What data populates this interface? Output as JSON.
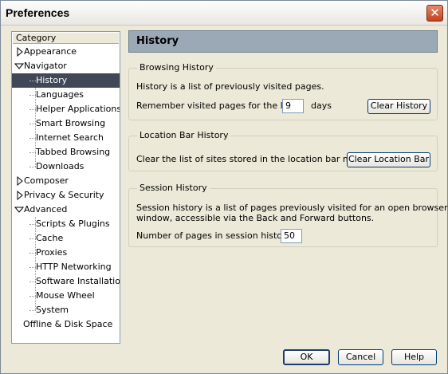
{
  "window": {
    "title": "Preferences"
  },
  "sidebar": {
    "header": "Category",
    "items": [
      {
        "label": "Appearance"
      },
      {
        "label": "Navigator"
      },
      {
        "label": "History"
      },
      {
        "label": "Languages"
      },
      {
        "label": "Helper Applications"
      },
      {
        "label": "Smart Browsing"
      },
      {
        "label": "Internet Search"
      },
      {
        "label": "Tabbed Browsing"
      },
      {
        "label": "Downloads"
      },
      {
        "label": "Composer"
      },
      {
        "label": "Privacy & Security"
      },
      {
        "label": "Advanced"
      },
      {
        "label": "Scripts & Plugins"
      },
      {
        "label": "Cache"
      },
      {
        "label": "Proxies"
      },
      {
        "label": "HTTP Networking"
      },
      {
        "label": "Software Installation"
      },
      {
        "label": "Mouse Wheel"
      },
      {
        "label": "System"
      },
      {
        "label": "Offline & Disk Space"
      }
    ]
  },
  "panel": {
    "title": "History",
    "browsing": {
      "legend": "Browsing History",
      "description": "History is a list of previously visited pages.",
      "remember_prefix": "Remember visited pages for the last",
      "days_value": "9",
      "days_unit": "days",
      "clear_button": "Clear History"
    },
    "location": {
      "legend": "Location Bar History",
      "description": "Clear the list of sites stored in the location bar menu.",
      "clear_button": "Clear Location Bar"
    },
    "session": {
      "legend": "Session History",
      "description_line1": "Session history is a list of pages previously visited for an open browser",
      "description_line2": "window, accessible via the Back and Forward buttons.",
      "pages_label": "Number of pages in session history:",
      "pages_value": "50"
    }
  },
  "footer": {
    "ok": "OK",
    "cancel": "Cancel",
    "help": "Help"
  }
}
